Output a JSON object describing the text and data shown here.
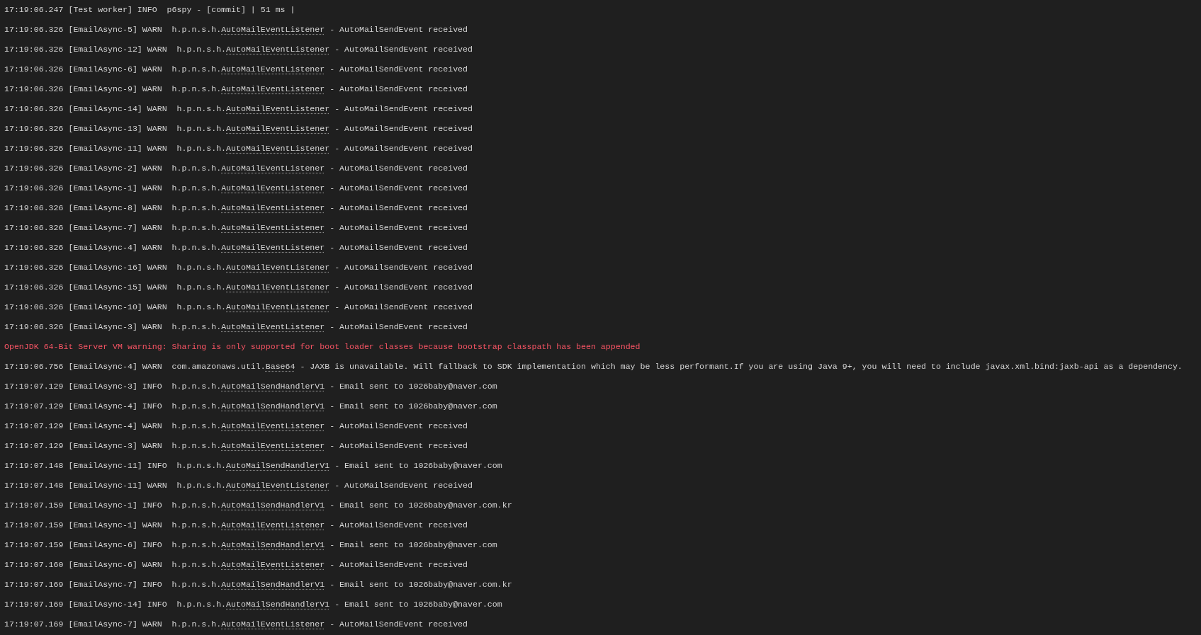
{
  "console_lines": [
    {
      "kind": "log",
      "head": "17:19:06.247 [Test worker] INFO  p6spy - [commit] | 51 ms |"
    },
    {
      "kind": "log",
      "head": "17:19:06.326 [EmailAsync-5] WARN  h.p.n.s.h.",
      "link": "AutoMailEventListener",
      "tail": " - AutoMailSendEvent received"
    },
    {
      "kind": "log",
      "head": "17:19:06.326 [EmailAsync-12] WARN  h.p.n.s.h.",
      "link": "AutoMailEventListener",
      "tail": " - AutoMailSendEvent received"
    },
    {
      "kind": "log",
      "head": "17:19:06.326 [EmailAsync-6] WARN  h.p.n.s.h.",
      "link": "AutoMailEventListener",
      "tail": " - AutoMailSendEvent received"
    },
    {
      "kind": "log",
      "head": "17:19:06.326 [EmailAsync-9] WARN  h.p.n.s.h.",
      "link": "AutoMailEventListener",
      "tail": " - AutoMailSendEvent received"
    },
    {
      "kind": "log",
      "head": "17:19:06.326 [EmailAsync-14] WARN  h.p.n.s.h.",
      "link": "AutoMailEventListener",
      "tail": " - AutoMailSendEvent received"
    },
    {
      "kind": "log",
      "head": "17:19:06.326 [EmailAsync-13] WARN  h.p.n.s.h.",
      "link": "AutoMailEventListener",
      "tail": " - AutoMailSendEvent received"
    },
    {
      "kind": "log",
      "head": "17:19:06.326 [EmailAsync-11] WARN  h.p.n.s.h.",
      "link": "AutoMailEventListener",
      "tail": " - AutoMailSendEvent received"
    },
    {
      "kind": "log",
      "head": "17:19:06.326 [EmailAsync-2] WARN  h.p.n.s.h.",
      "link": "AutoMailEventListener",
      "tail": " - AutoMailSendEvent received"
    },
    {
      "kind": "log",
      "head": "17:19:06.326 [EmailAsync-1] WARN  h.p.n.s.h.",
      "link": "AutoMailEventListener",
      "tail": " - AutoMailSendEvent received"
    },
    {
      "kind": "log",
      "head": "17:19:06.326 [EmailAsync-8] WARN  h.p.n.s.h.",
      "link": "AutoMailEventListener",
      "tail": " - AutoMailSendEvent received"
    },
    {
      "kind": "log",
      "head": "17:19:06.326 [EmailAsync-7] WARN  h.p.n.s.h.",
      "link": "AutoMailEventListener",
      "tail": " - AutoMailSendEvent received"
    },
    {
      "kind": "log",
      "head": "17:19:06.326 [EmailAsync-4] WARN  h.p.n.s.h.",
      "link": "AutoMailEventListener",
      "tail": " - AutoMailSendEvent received"
    },
    {
      "kind": "log",
      "head": "17:19:06.326 [EmailAsync-16] WARN  h.p.n.s.h.",
      "link": "AutoMailEventListener",
      "tail": " - AutoMailSendEvent received"
    },
    {
      "kind": "log",
      "head": "17:19:06.326 [EmailAsync-15] WARN  h.p.n.s.h.",
      "link": "AutoMailEventListener",
      "tail": " - AutoMailSendEvent received"
    },
    {
      "kind": "log",
      "head": "17:19:06.326 [EmailAsync-10] WARN  h.p.n.s.h.",
      "link": "AutoMailEventListener",
      "tail": " - AutoMailSendEvent received"
    },
    {
      "kind": "log",
      "head": "17:19:06.326 [EmailAsync-3] WARN  h.p.n.s.h.",
      "link": "AutoMailEventListener",
      "tail": " - AutoMailSendEvent received"
    },
    {
      "kind": "error",
      "head": "OpenJDK 64-Bit Server VM warning: Sharing is only supported for boot loader classes because bootstrap classpath has been appended"
    },
    {
      "kind": "log",
      "head": "17:19:06.756 [EmailAsync-4] WARN  com.amazonaws.util.",
      "link": "Base64",
      "tail": " - JAXB is unavailable. Will fallback to SDK implementation which may be less performant.If you are using Java 9+, you will need to include javax.xml.bind:jaxb-api as a dependency."
    },
    {
      "kind": "log",
      "head": "17:19:07.129 [EmailAsync-3] INFO  h.p.n.s.h.",
      "link": "AutoMailSendHandlerV1",
      "tail": " - Email sent to 1026baby@naver.com"
    },
    {
      "kind": "log",
      "head": "17:19:07.129 [EmailAsync-4] INFO  h.p.n.s.h.",
      "link": "AutoMailSendHandlerV1",
      "tail": " - Email sent to 1026baby@naver.com"
    },
    {
      "kind": "log",
      "head": "17:19:07.129 [EmailAsync-4] WARN  h.p.n.s.h.",
      "link": "AutoMailEventListener",
      "tail": " - AutoMailSendEvent received"
    },
    {
      "kind": "log",
      "head": "17:19:07.129 [EmailAsync-3] WARN  h.p.n.s.h.",
      "link": "AutoMailEventListener",
      "tail": " - AutoMailSendEvent received"
    },
    {
      "kind": "log",
      "head": "17:19:07.148 [EmailAsync-11] INFO  h.p.n.s.h.",
      "link": "AutoMailSendHandlerV1",
      "tail": " - Email sent to 1026baby@naver.com"
    },
    {
      "kind": "log",
      "head": "17:19:07.148 [EmailAsync-11] WARN  h.p.n.s.h.",
      "link": "AutoMailEventListener",
      "tail": " - AutoMailSendEvent received"
    },
    {
      "kind": "log",
      "head": "17:19:07.159 [EmailAsync-1] INFO  h.p.n.s.h.",
      "link": "AutoMailSendHandlerV1",
      "tail": " - Email sent to 1026baby@naver.com.kr"
    },
    {
      "kind": "log",
      "head": "17:19:07.159 [EmailAsync-1] WARN  h.p.n.s.h.",
      "link": "AutoMailEventListener",
      "tail": " - AutoMailSendEvent received"
    },
    {
      "kind": "log",
      "head": "17:19:07.159 [EmailAsync-6] INFO  h.p.n.s.h.",
      "link": "AutoMailSendHandlerV1",
      "tail": " - Email sent to 1026baby@naver.com"
    },
    {
      "kind": "log",
      "head": "17:19:07.160 [EmailAsync-6] WARN  h.p.n.s.h.",
      "link": "AutoMailEventListener",
      "tail": " - AutoMailSendEvent received"
    },
    {
      "kind": "log",
      "head": "17:19:07.169 [EmailAsync-7] INFO  h.p.n.s.h.",
      "link": "AutoMailSendHandlerV1",
      "tail": " - Email sent to 1026baby@naver.com.kr"
    },
    {
      "kind": "log",
      "head": "17:19:07.169 [EmailAsync-14] INFO  h.p.n.s.h.",
      "link": "AutoMailSendHandlerV1",
      "tail": " - Email sent to 1026baby@naver.com"
    },
    {
      "kind": "log",
      "head": "17:19:07.169 [EmailAsync-7] WARN  h.p.n.s.h.",
      "link": "AutoMailEventListener",
      "tail": " - AutoMailSendEvent received"
    }
  ]
}
